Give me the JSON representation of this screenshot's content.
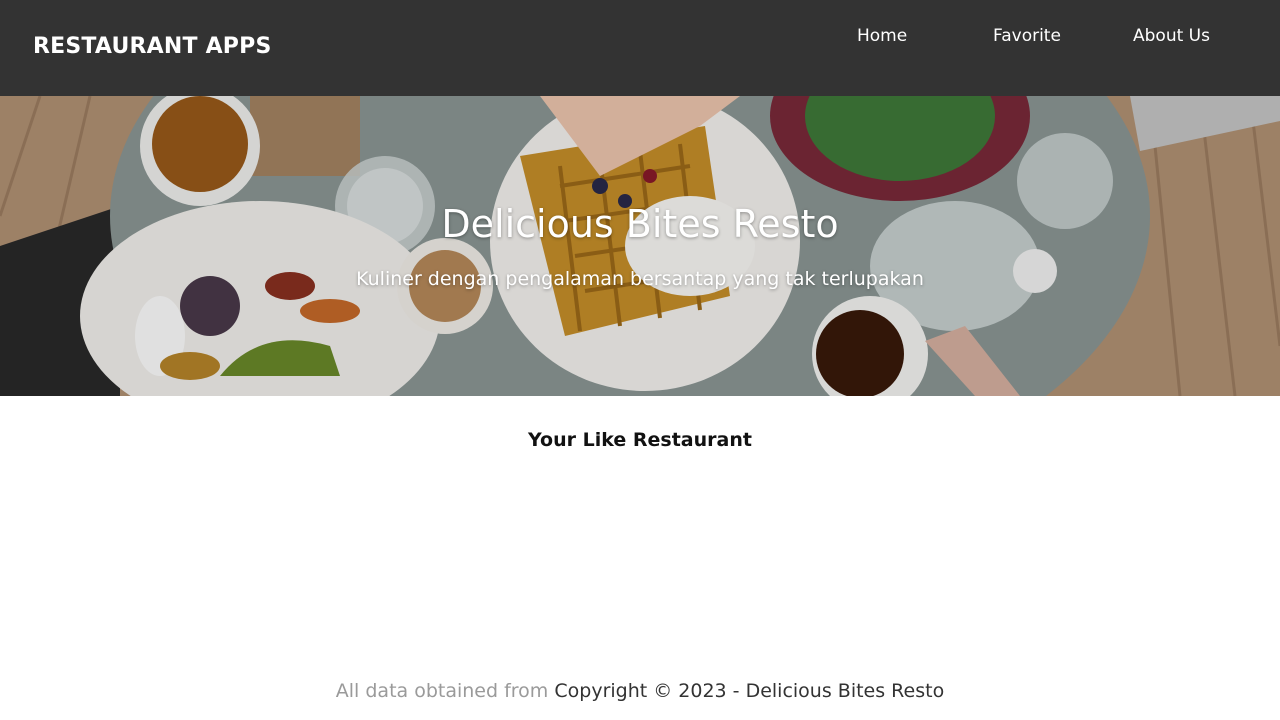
{
  "header": {
    "brand": "RESTAURANT APPS",
    "nav": [
      {
        "label": "Home"
      },
      {
        "label": "Favorite"
      },
      {
        "label": "About Us"
      }
    ]
  },
  "hero": {
    "title": "Delicious Bites Resto",
    "tagline": "Kuliner dengan pengalaman bersantap yang tak terlupakan",
    "image": "restaurant-table-food-photo"
  },
  "main": {
    "section_title": "Your Like Restaurant",
    "restaurants": []
  },
  "footer": {
    "source_text": "All data obtained from",
    "copyright": "Copyright © 2023 - Delicious Bites Resto"
  },
  "colors": {
    "header_bg": "#333333",
    "header_text": "#ffffff",
    "footer_muted": "#9a9a9a",
    "footer_text": "#333333"
  }
}
